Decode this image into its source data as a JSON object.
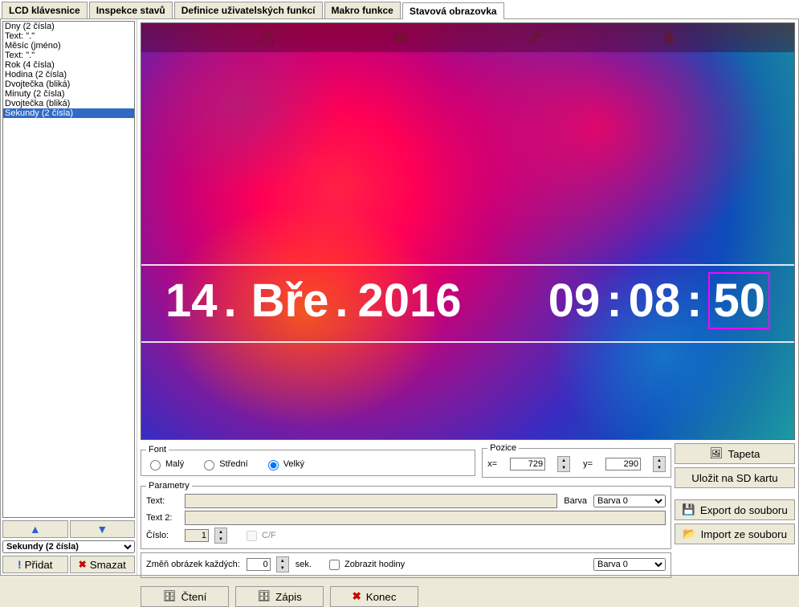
{
  "tabs": [
    "LCD klávesnice",
    "Inspekce stavů",
    "Definice uživatelských funkcí",
    "Makro funkce",
    "Stavová obrazovka"
  ],
  "active_tab": 4,
  "list_items": [
    "Dny (2 čísla)",
    "Text: \".\"",
    "Měsíc (jméno)",
    "Text: \".\"",
    "Rok (4 čísla)",
    "Hodina (2 čísla)",
    "Dvojtečka (bliká)",
    "Minuty (2 čísla)",
    "Dvojtečka (bliká)",
    "Sekundy (2 čísla)"
  ],
  "selected_list_index": 9,
  "combo_value": "Sekundy (2 čísla)",
  "move_up_icon": "▲",
  "move_down_icon": "▼",
  "add_button": "Přidat",
  "delete_button": "Smazat",
  "preview": {
    "date_day": "14",
    "date_dot1": ".",
    "date_month": "Bře",
    "date_dot2": ".",
    "date_year": "2016",
    "time_h": "09",
    "colon": ":",
    "time_m": "08",
    "time_s": "50"
  },
  "font": {
    "legend": "Font",
    "small": "Malý",
    "medium": "Střední",
    "large": "Velký",
    "selected": "large"
  },
  "position": {
    "legend": "Pozice",
    "x_label": "x=",
    "x_value": "729",
    "y_label": "y=",
    "y_value": "290"
  },
  "params": {
    "legend": "Parametry",
    "text_label": "Text:",
    "text_value": "",
    "text2_label": "Text 2:",
    "text2_value": "",
    "number_label": "Číslo:",
    "number_value": "1",
    "cf_label": "C/F",
    "barva_label": "Barva",
    "barva_value": "Barva 0"
  },
  "change_img": {
    "label": "Změň obrázek každých:",
    "value": "0",
    "sek": "sek.",
    "show_clock": "Zobrazit hodiny",
    "barva_value": "Barva 0"
  },
  "side_buttons": {
    "tapeta": "Tapeta",
    "save_sd": "Uložit na SD kartu",
    "export": "Export do souboru",
    "import": "Import ze souboru"
  },
  "bottom": {
    "read": "Čtení",
    "write": "Zápis",
    "end": "Konec"
  }
}
